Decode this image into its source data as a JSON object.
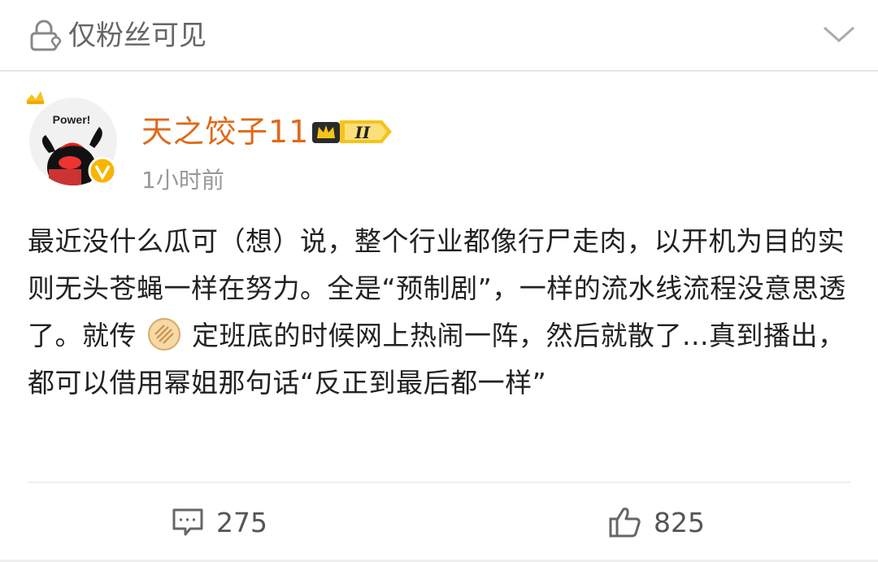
{
  "header": {
    "visibility_label": "仅粉丝可见"
  },
  "author": {
    "name": "天之饺子11",
    "level_badge": "II",
    "avatar_text": "Power!",
    "post_time": "1小时前"
  },
  "post": {
    "text_before_emoji": "最近没什么瓜可（想）说，整个行业都像行尸走肉，以开机为目的实则无头苍蝇一样在努力。全是“预制剧”，一样的流水线流程没意思透了。就传",
    "emoji_name": "pancake-emoji",
    "text_after_emoji": "定班底的时候网上热闹一阵，然后就散了...真到播出，都可以借用幂姐那句话“反正到最后都一样”"
  },
  "actions": {
    "comments": "275",
    "likes": "825"
  },
  "colors": {
    "username": "#e0691a",
    "muted": "#999999",
    "badge_gold": "#f5c518"
  },
  "icons": [
    "lock-icon",
    "chevron-down-icon",
    "crown-icon",
    "verified-icon",
    "comment-icon",
    "thumbs-up-icon"
  ]
}
